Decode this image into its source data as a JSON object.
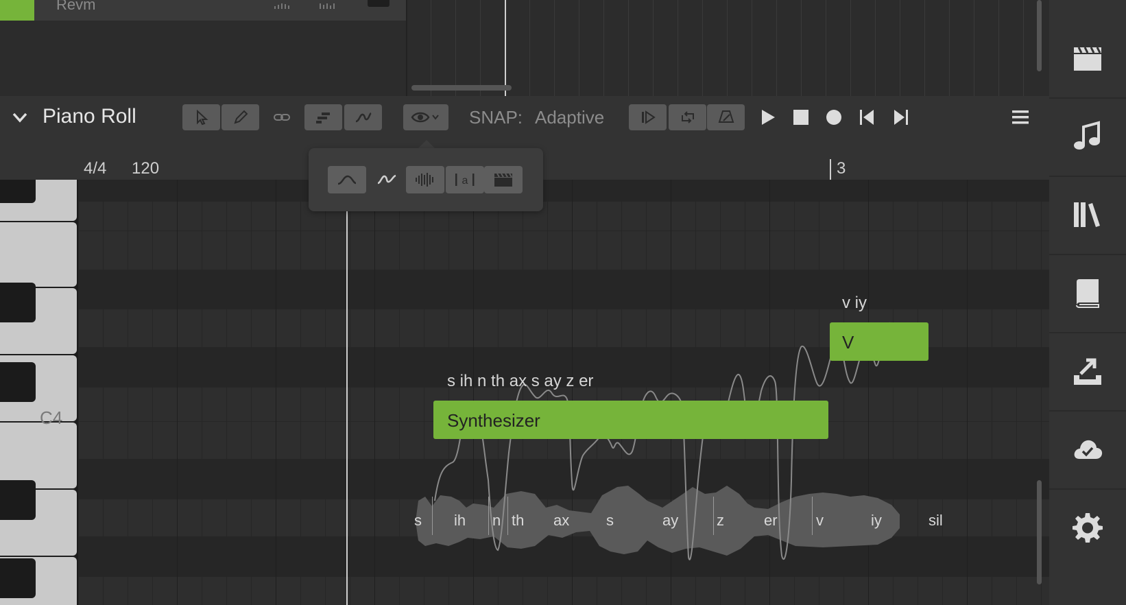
{
  "track": {
    "name": "Revm"
  },
  "piano_roll": {
    "title": "Piano Roll",
    "snap_label": "SNAP:",
    "snap_value": "Adaptive",
    "time_signature": "4/4",
    "tempo": "120",
    "bar_marker": "3",
    "key_label": "C4"
  },
  "notes": [
    {
      "lyric": "Synthesizer",
      "phonemes": "s ih n th ax s ay z er"
    },
    {
      "lyric": "V",
      "phonemes": "v iy"
    }
  ],
  "phoneme_track": [
    "s",
    "ih",
    "n",
    "th",
    "ax",
    "s",
    "ay",
    "z",
    "er",
    "v",
    "iy",
    "sil"
  ],
  "colors": {
    "accent": "#76b43a",
    "background": "#2e2e2e"
  },
  "sidebar": [
    "film-clapper-icon",
    "music-note-icon",
    "library-icon",
    "book-icon",
    "export-icon",
    "cloud-check-icon",
    "settings-icon"
  ]
}
